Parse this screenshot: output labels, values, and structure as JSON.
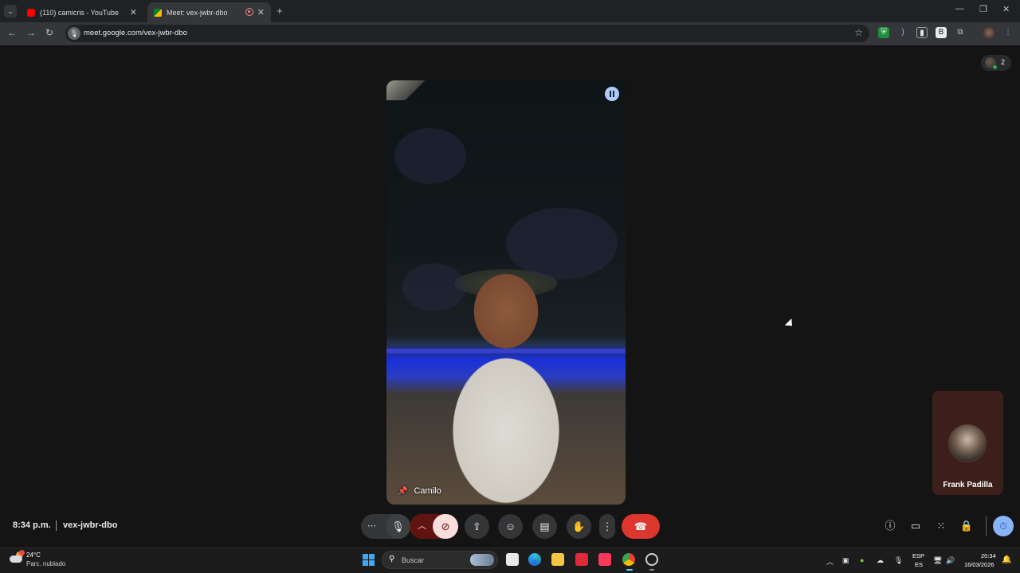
{
  "browser": {
    "tabs": [
      {
        "title": "(110) camicris - YouTube",
        "active": false
      },
      {
        "title": "Meet: vex-jwbr-dbo",
        "active": true
      }
    ],
    "url": "meet.google.com/vex-jwbr-dbo"
  },
  "meet": {
    "participant_count": "2",
    "main_participant": {
      "name": "Camilo"
    },
    "side_participant": {
      "name": "Frank Padilla"
    },
    "time": "8:34 p.m.",
    "meeting_code": "vex-jwbr-dbo",
    "camera_off": true,
    "colors": {
      "end_call": "#dc362e",
      "camera_off_bg": "#f9dedc",
      "timer": "#8ab4f8"
    }
  },
  "taskbar": {
    "weather": {
      "temp": "24°C",
      "condition": "Parc. nublado"
    },
    "search_placeholder": "Buscar",
    "lang_line1": "ESP",
    "lang_line2": "ES",
    "clock_time": "20:34",
    "clock_date": "16/03/2026"
  }
}
